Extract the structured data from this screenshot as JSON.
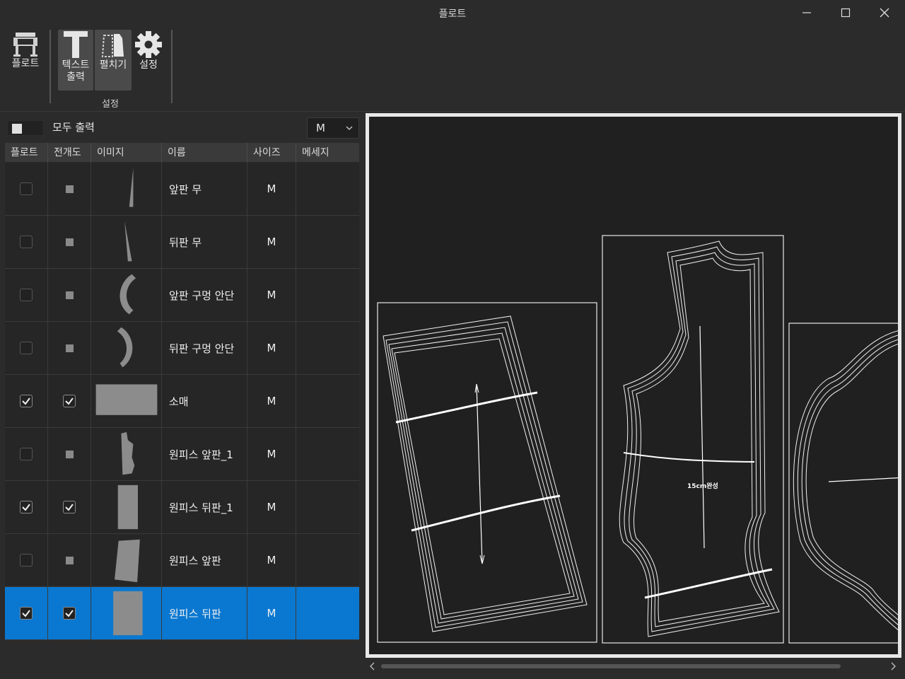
{
  "window": {
    "title": "플로트"
  },
  "ribbon": {
    "plot_label": "플로트",
    "text_output_label": "텍스트\n출력",
    "unfold_label": "펼치기",
    "settings_label": "설정",
    "group_label": "설정"
  },
  "toolbar": {
    "all_output_label": "모두 출력",
    "size_value": "M"
  },
  "table": {
    "headers": [
      "플로트",
      "전개도",
      "이미지",
      "이름",
      "사이즈",
      "메세지"
    ],
    "rows": [
      {
        "plot": false,
        "unfold": "partial",
        "name": "앞판 무",
        "size": "M",
        "message": "",
        "shape": "front-gusset",
        "selected": false
      },
      {
        "plot": false,
        "unfold": "partial",
        "name": "뒤판 무",
        "size": "M",
        "message": "",
        "shape": "back-gusset",
        "selected": false
      },
      {
        "plot": false,
        "unfold": "partial",
        "name": "앞판 구멍 안단",
        "size": "M",
        "message": "",
        "shape": "front-facing",
        "selected": false
      },
      {
        "plot": false,
        "unfold": "partial",
        "name": "뒤판 구멍 안단",
        "size": "M",
        "message": "",
        "shape": "back-facing",
        "selected": false
      },
      {
        "plot": true,
        "unfold": "checked",
        "name": "소매",
        "size": "M",
        "message": "",
        "shape": "sleeve",
        "selected": false
      },
      {
        "plot": false,
        "unfold": "partial",
        "name": "원피스 앞판_1",
        "size": "M",
        "message": "",
        "shape": "dress-front-1",
        "selected": false
      },
      {
        "plot": true,
        "unfold": "checked",
        "name": "원피스 뒤판_1",
        "size": "M",
        "message": "",
        "shape": "dress-back-1",
        "selected": false
      },
      {
        "plot": false,
        "unfold": "partial",
        "name": "원피스 앞판",
        "size": "M",
        "message": "",
        "shape": "dress-front",
        "selected": false
      },
      {
        "plot": true,
        "unfold": "checked",
        "name": "원피스 뒤판",
        "size": "M",
        "message": "",
        "shape": "dress-back",
        "selected": true
      }
    ]
  },
  "preview": {
    "pieces": [
      {
        "name": "sleeve-piece",
        "label": ""
      },
      {
        "name": "bodice-piece",
        "label": "15cm완성"
      },
      {
        "name": "curved-piece",
        "label": ""
      }
    ]
  },
  "colors": {
    "selection": "#0a78d1",
    "canvas": "#202020",
    "line": "#f0f0f0"
  }
}
